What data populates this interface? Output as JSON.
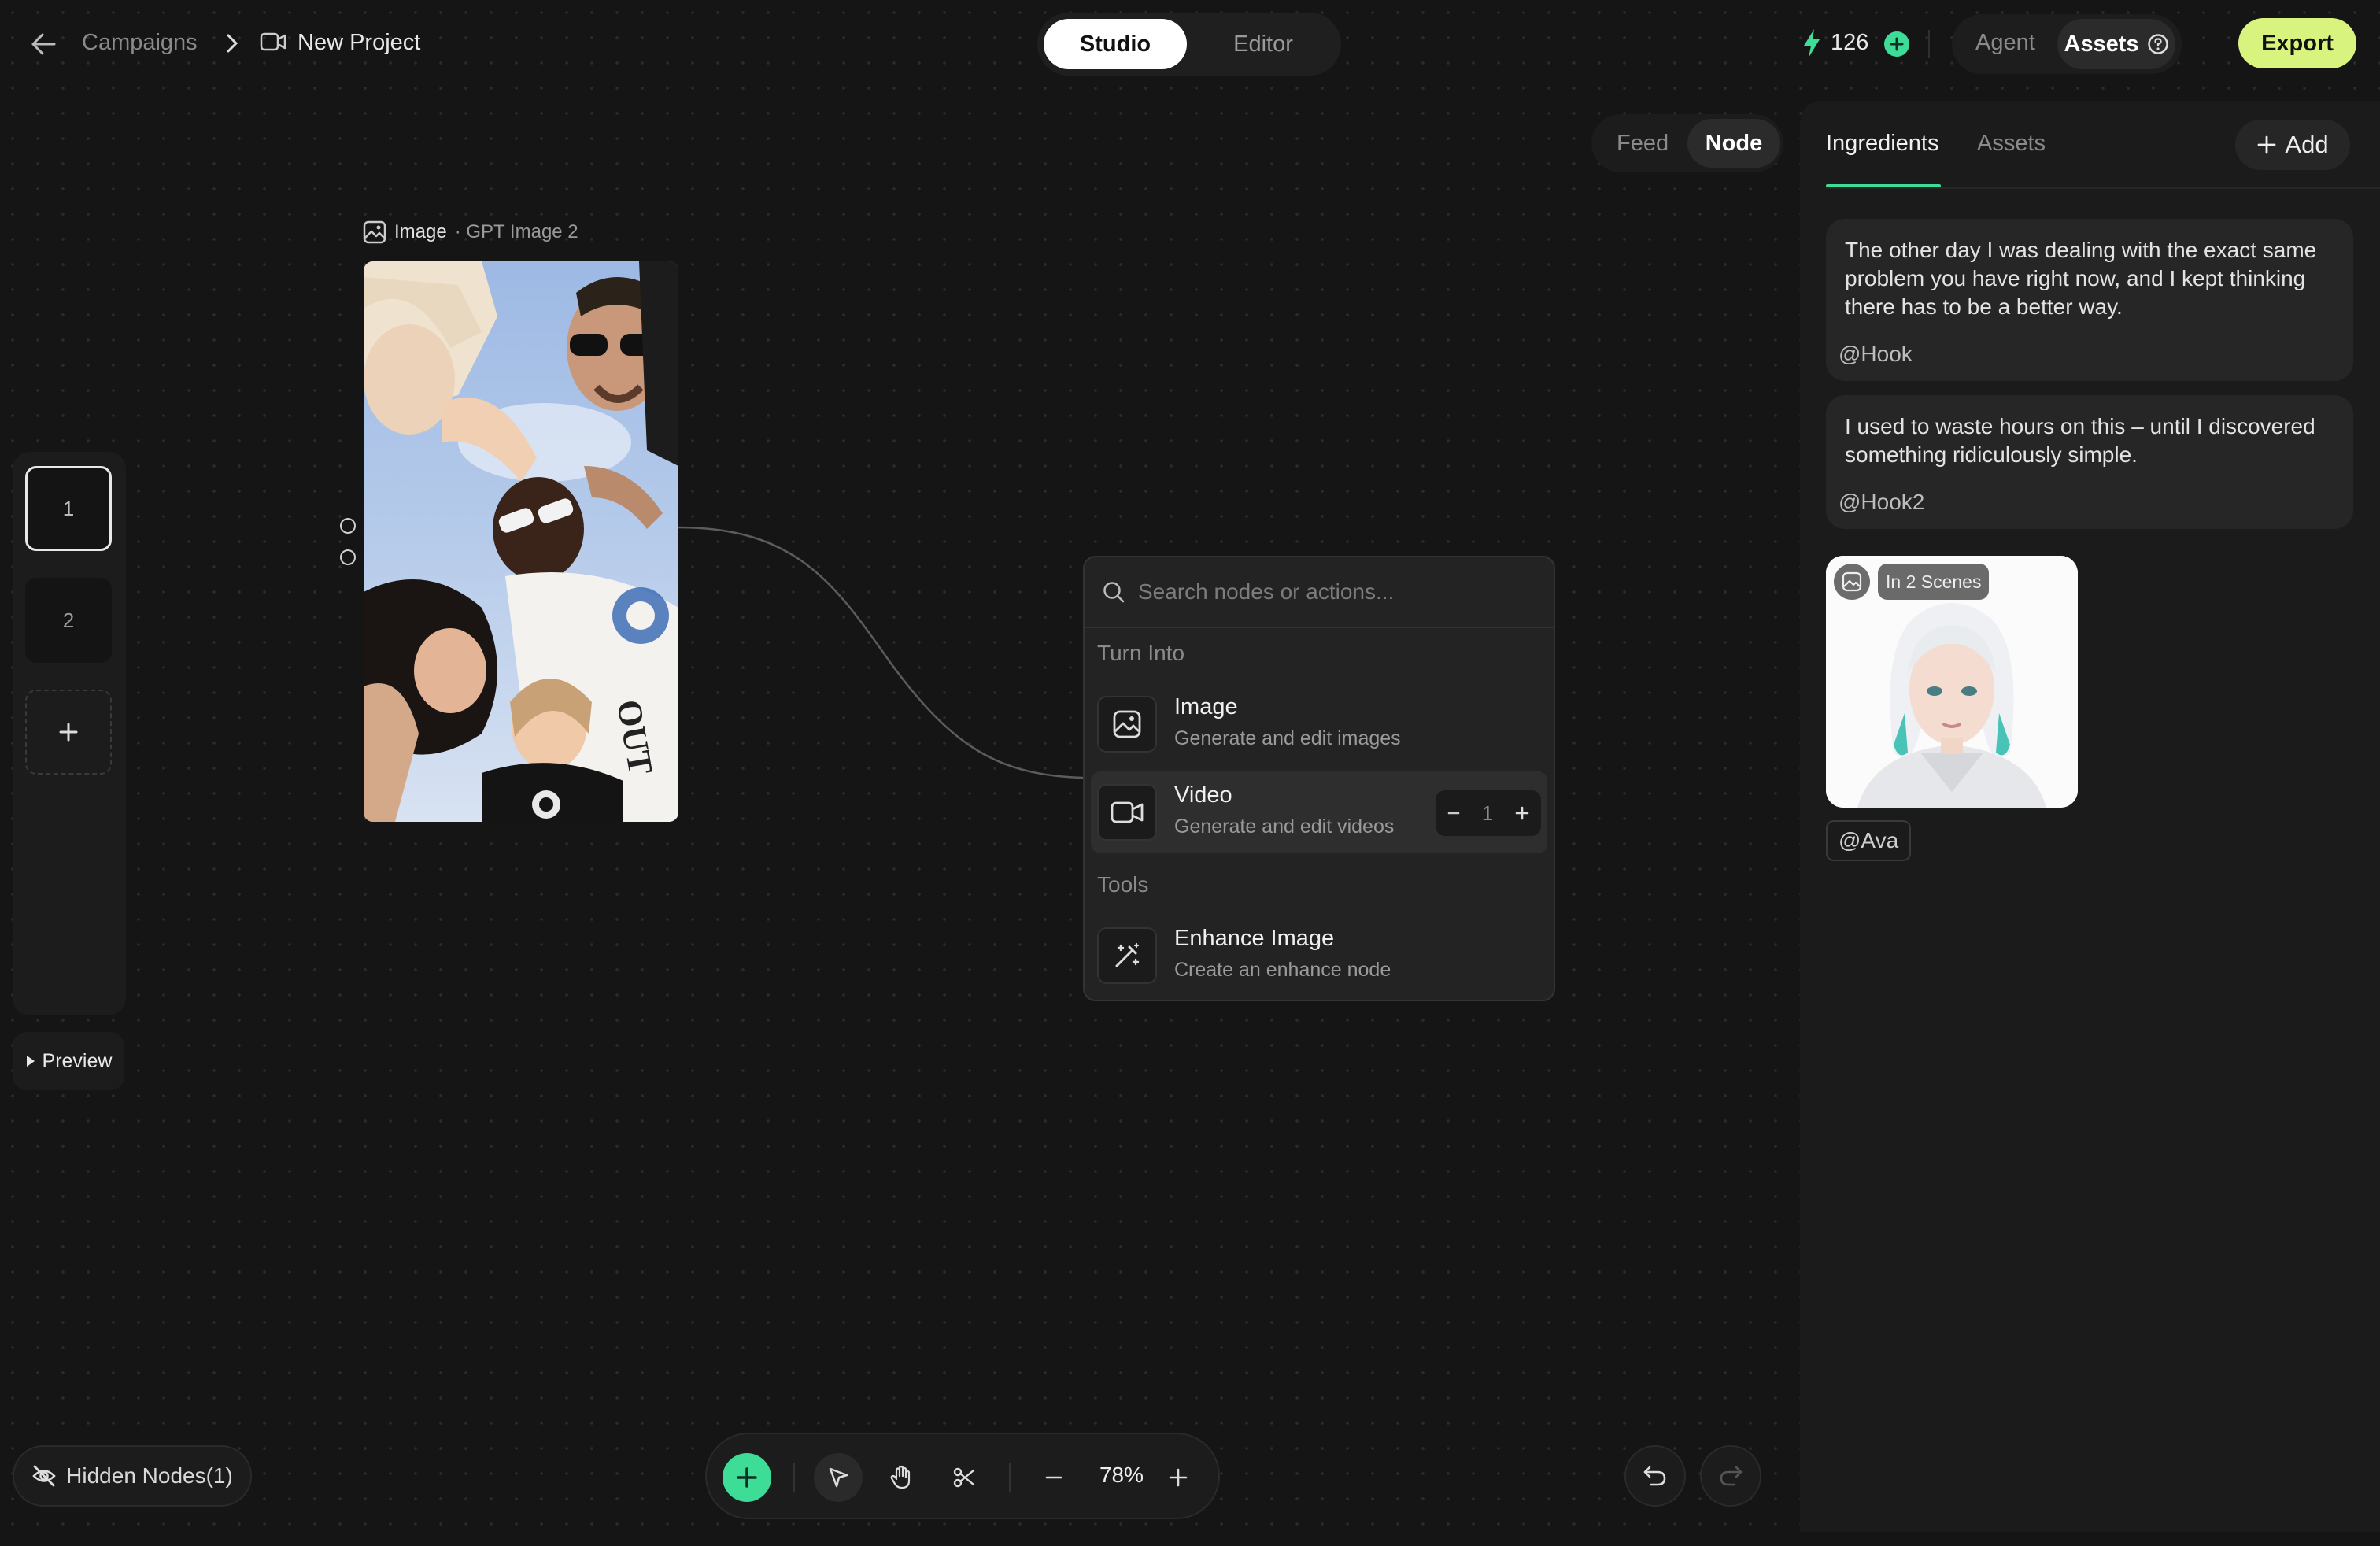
{
  "topbar": {
    "breadcrumb_parent": "Campaigns",
    "project_name": "New Project",
    "mode_tabs": [
      "Studio",
      "Editor"
    ],
    "active_mode": "Studio",
    "credits": "126",
    "agent_label": "Agent",
    "assets_label": "Assets",
    "export_label": "Export"
  },
  "view_toggle": {
    "feed_label": "Feed",
    "node_label": "Node",
    "active": "Node"
  },
  "left_rail": {
    "slides": [
      "1",
      "2"
    ],
    "preview_label": "Preview"
  },
  "node": {
    "type_label": "Image",
    "model_label": "· GPT Image 2"
  },
  "action_menu": {
    "search_placeholder": "Search nodes or actions...",
    "section_turn_into": "Turn Into",
    "items": [
      {
        "title": "Image",
        "subtitle": "Generate and edit images"
      },
      {
        "title": "Video",
        "subtitle": "Generate and edit videos",
        "count": "1"
      }
    ],
    "section_tools": "Tools",
    "tools": [
      {
        "title": "Enhance Image",
        "subtitle": "Create an enhance node"
      }
    ]
  },
  "right_panel": {
    "tabs": [
      "Ingredients",
      "Assets"
    ],
    "active_tab": "Ingredients",
    "add_label": "Add",
    "cards": [
      {
        "text": "The other day I was dealing with the exact same problem you have right now, and I kept thinking there has to be a better way.",
        "tag": "@Hook"
      },
      {
        "text": "I used to waste hours on this – until I discovered something ridiculously simple.",
        "tag": "@Hook2"
      }
    ],
    "asset_badge": "In 2 Scenes",
    "asset_tag": "@Ava"
  },
  "bottom": {
    "hidden_nodes_label": "Hidden Nodes(1)",
    "zoom_level": "78%"
  },
  "colors": {
    "accent_green": "#3ddc97",
    "export_bg": "#d9f47e",
    "background": "#151515"
  }
}
